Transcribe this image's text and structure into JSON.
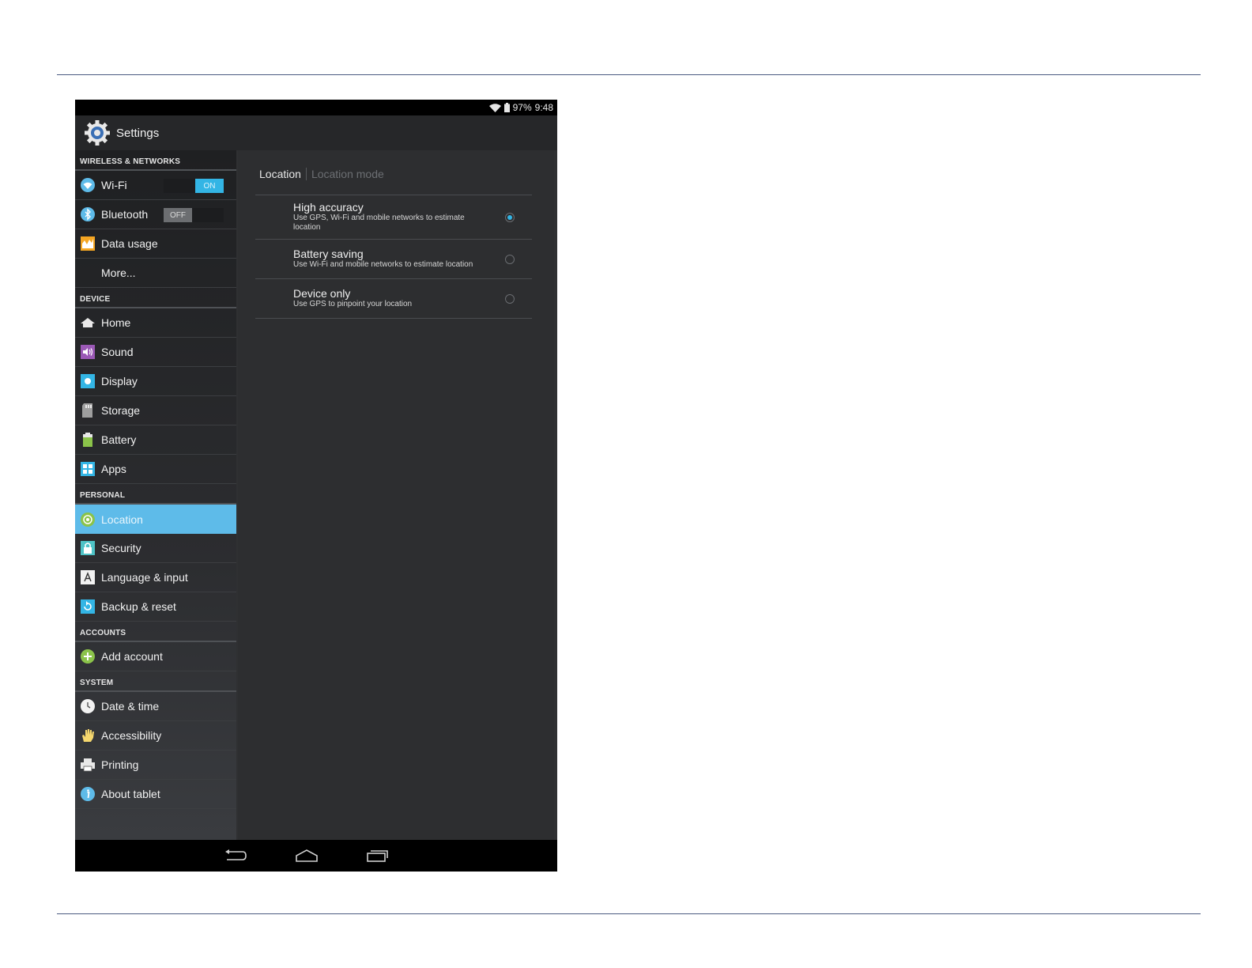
{
  "status": {
    "battery": "97%",
    "time": "9:48"
  },
  "app": {
    "title": "Settings"
  },
  "sidebar": {
    "sections": {
      "wireless": "WIRELESS & NETWORKS",
      "device": "DEVICE",
      "personal": "PERSONAL",
      "accounts": "ACCOUNTS",
      "system": "SYSTEM"
    },
    "items": {
      "wifi": "Wi-Fi",
      "wifi_toggle": "ON",
      "bluetooth": "Bluetooth",
      "bluetooth_toggle": "OFF",
      "data_usage": "Data usage",
      "more": "More...",
      "home": "Home",
      "sound": "Sound",
      "display": "Display",
      "storage": "Storage",
      "battery": "Battery",
      "apps": "Apps",
      "location": "Location",
      "security": "Security",
      "language": "Language & input",
      "backup": "Backup & reset",
      "add_account": "Add account",
      "date_time": "Date & time",
      "accessibility": "Accessibility",
      "printing": "Printing",
      "about": "About tablet"
    },
    "selected": "Location"
  },
  "content": {
    "breadcrumb": {
      "current": "Location",
      "sub": "Location mode"
    },
    "options": [
      {
        "title": "High accuracy",
        "desc": "Use GPS, Wi-Fi and mobile networks to estimate location",
        "selected": true
      },
      {
        "title": "Battery saving",
        "desc": "Use Wi-Fi and mobile networks to estimate location",
        "selected": false
      },
      {
        "title": "Device only",
        "desc": "Use GPS to pinpoint your location",
        "selected": false
      }
    ]
  },
  "colors": {
    "accent": "#33b5e5",
    "selected_row": "#5ebbe9"
  }
}
